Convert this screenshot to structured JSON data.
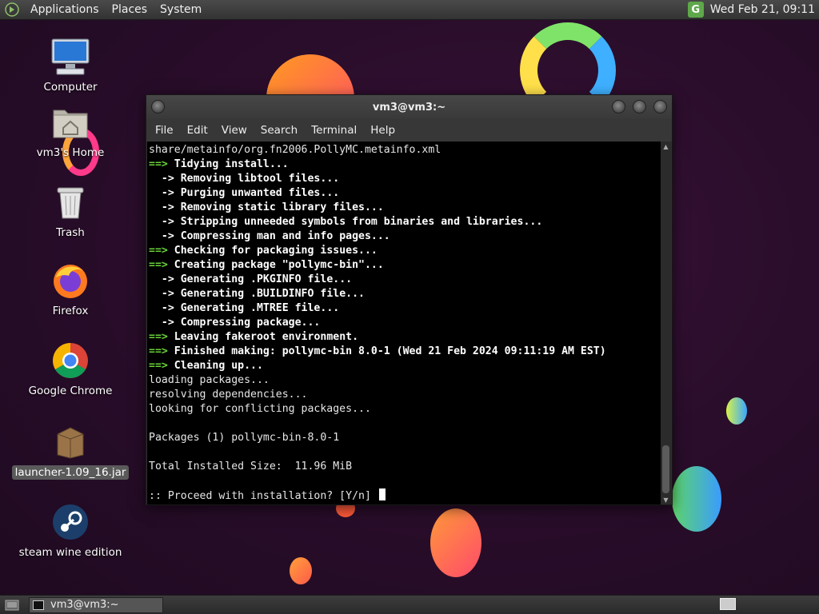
{
  "top_panel": {
    "menus": [
      "Applications",
      "Places",
      "System"
    ],
    "clock": "Wed Feb 21, 09:11",
    "tray_icon": "G"
  },
  "desktop_icons": [
    {
      "label": "Computer",
      "icon": "computer-icon"
    },
    {
      "label": "vm3's Home",
      "icon": "home-folder-icon"
    },
    {
      "label": "Trash",
      "icon": "trash-icon"
    },
    {
      "label": "Firefox",
      "icon": "firefox-icon"
    },
    {
      "label": "Google Chrome",
      "icon": "chrome-icon"
    },
    {
      "label": "launcher-1.09_16.jar",
      "icon": "jar-package-icon",
      "selected": true
    },
    {
      "label": "steam wine edition",
      "icon": "steam-icon"
    }
  ],
  "terminal": {
    "title": "vm3@vm3:~",
    "menu": [
      "File",
      "Edit",
      "View",
      "Search",
      "Terminal",
      "Help"
    ],
    "lines": [
      {
        "prefix": "",
        "text": "share/metainfo/org.fn2006.PollyMC.metainfo.xml",
        "style": "plain"
      },
      {
        "prefix": "==>",
        "text": " Tidying install...",
        "style": "green"
      },
      {
        "prefix": "  ->",
        "text": " Removing libtool files...",
        "style": "arrow"
      },
      {
        "prefix": "  ->",
        "text": " Purging unwanted files...",
        "style": "arrow"
      },
      {
        "prefix": "  ->",
        "text": " Removing static library files...",
        "style": "arrow"
      },
      {
        "prefix": "  ->",
        "text": " Stripping unneeded symbols from binaries and libraries...",
        "style": "arrow"
      },
      {
        "prefix": "  ->",
        "text": " Compressing man and info pages...",
        "style": "arrow"
      },
      {
        "prefix": "==>",
        "text": " Checking for packaging issues...",
        "style": "green"
      },
      {
        "prefix": "==>",
        "text": " Creating package \"pollymc-bin\"...",
        "style": "green"
      },
      {
        "prefix": "  ->",
        "text": " Generating .PKGINFO file...",
        "style": "arrow"
      },
      {
        "prefix": "  ->",
        "text": " Generating .BUILDINFO file...",
        "style": "arrow"
      },
      {
        "prefix": "  ->",
        "text": " Generating .MTREE file...",
        "style": "arrow"
      },
      {
        "prefix": "  ->",
        "text": " Compressing package...",
        "style": "arrow"
      },
      {
        "prefix": "==>",
        "text": " Leaving fakeroot environment.",
        "style": "green"
      },
      {
        "prefix": "==>",
        "text": " Finished making: pollymc-bin 8.0-1 (Wed 21 Feb 2024 09:11:19 AM EST)",
        "style": "green"
      },
      {
        "prefix": "==>",
        "text": " Cleaning up...",
        "style": "green"
      },
      {
        "prefix": "",
        "text": "loading packages...",
        "style": "plain"
      },
      {
        "prefix": "",
        "text": "resolving dependencies...",
        "style": "plain"
      },
      {
        "prefix": "",
        "text": "looking for conflicting packages...",
        "style": "plain"
      },
      {
        "prefix": "",
        "text": "",
        "style": "plain"
      },
      {
        "prefix": "",
        "text": "Packages (1) pollymc-bin-8.0-1",
        "style": "plain"
      },
      {
        "prefix": "",
        "text": "",
        "style": "plain"
      },
      {
        "prefix": "",
        "text": "Total Installed Size:  11.96 MiB",
        "style": "plain"
      },
      {
        "prefix": "",
        "text": "",
        "style": "plain"
      },
      {
        "prefix": "",
        "text": ":: Proceed with installation? [Y/n] ",
        "style": "prompt"
      }
    ]
  },
  "taskbar": {
    "tasks": [
      {
        "label": "vm3@vm3:~"
      }
    ]
  },
  "colors": {
    "prompt_green": "#6ad33a",
    "desktop_bg": "#2a0d2b",
    "panel_bg": "#3a3a3a"
  }
}
